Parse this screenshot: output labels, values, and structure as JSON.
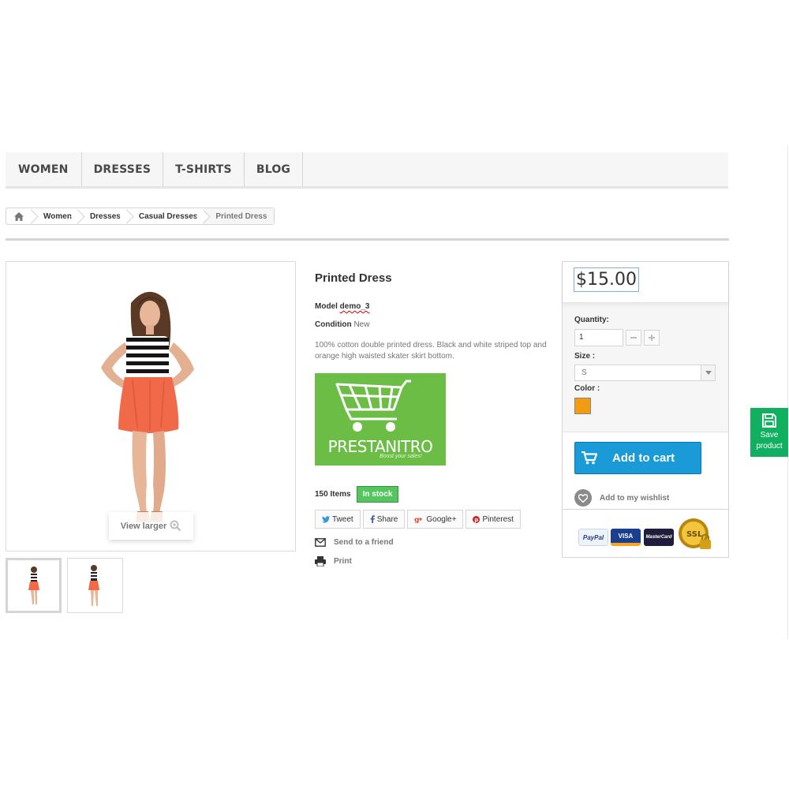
{
  "nav": {
    "items": [
      {
        "label": "WOMEN"
      },
      {
        "label": "DRESSES"
      },
      {
        "label": "T-SHIRTS"
      },
      {
        "label": "BLOG"
      }
    ]
  },
  "breadcrumb": {
    "home_icon": "home-icon",
    "items": [
      "Women",
      "Dresses",
      "Casual Dresses",
      "Printed Dress"
    ]
  },
  "image": {
    "view_larger": "View larger",
    "thumbnails_count": 2
  },
  "product": {
    "title": "Printed Dress",
    "model_label": "Model",
    "model_value": "demo_3",
    "condition_label": "Condition",
    "condition_value": "New",
    "description": "100% cotton double printed dress. Black and white striped top and orange high waisted skater skirt bottom.",
    "brand": {
      "name": "PRESTANITRO",
      "tagline": "Boost your sales!",
      "color": "#6bbd45"
    },
    "items_count": "150 Items",
    "stock_status": "In stock"
  },
  "social": {
    "tweet": "Tweet",
    "share": "Share",
    "google": "Google+",
    "pinterest": "Pinterest"
  },
  "links": {
    "send_to_friend": "Send to a friend",
    "print": "Print"
  },
  "buy_box": {
    "price": "$15.00",
    "quantity_label": "Quantity:",
    "quantity_value": "1",
    "size_label": "Size :",
    "size_value": "S",
    "color_label": "Color :",
    "color_value": "#f39c11",
    "add_to_cart": "Add to cart",
    "add_to_wishlist": "Add to my wishlist",
    "accent": "#1a9ad6",
    "payment_logos": {
      "paypal": "PayPal",
      "visa": "VISA",
      "mastercard": "MasterCard",
      "ssl": "SSL"
    }
  },
  "save_widget": {
    "line1": "Save",
    "line2": "product",
    "color": "#11b060"
  }
}
